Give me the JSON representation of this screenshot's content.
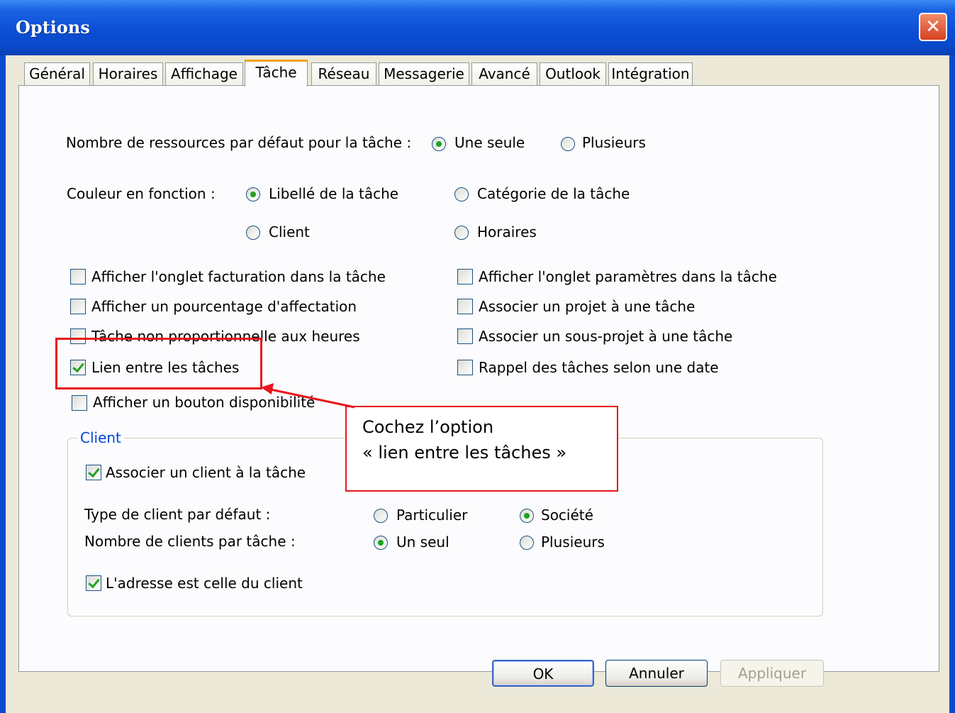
{
  "window": {
    "title": "Options"
  },
  "tabs": [
    "Général",
    "Horaires",
    "Affichage",
    "Tâche",
    "Réseau",
    "Messagerie",
    "Avancé",
    "Outlook",
    "Intégration"
  ],
  "active_tab": "Tâche",
  "task": {
    "resources_label": "Nombre de ressources par défaut pour la tâche :",
    "resources_one": "Une seule",
    "resources_many": "Plusieurs",
    "color_label": "Couleur en fonction :",
    "color_task_label": "Libellé de la tâche",
    "color_category": "Catégorie de la tâche",
    "color_client": "Client",
    "color_schedule": "Horaires",
    "checks_left": [
      {
        "label": "Afficher l'onglet facturation dans la tâche",
        "checked": false
      },
      {
        "label": "Afficher un pourcentage d'affectation",
        "checked": false
      },
      {
        "label": "Tâche non proportionnelle aux heures",
        "checked": false
      },
      {
        "label": "Lien entre les tâches",
        "checked": true
      },
      {
        "label": "Afficher un bouton disponibilité",
        "checked": false
      }
    ],
    "checks_right": [
      {
        "label": "Afficher l'onglet paramètres dans la tâche",
        "checked": false
      },
      {
        "label": "Associer un projet à une tâche",
        "checked": false
      },
      {
        "label": "Associer un sous-projet à une tâche",
        "checked": false
      },
      {
        "label": "Rappel des tâches selon une date",
        "checked": false
      }
    ]
  },
  "client_group": {
    "title": "Client",
    "associate": "Associer un client à la tâche",
    "type_label": "Type de client par défaut :",
    "type_individual": "Particulier",
    "type_company": "Société",
    "count_label": "Nombre de clients par tâche :",
    "count_one": "Un seul",
    "count_many": "Plusieurs",
    "address": "L'adresse est celle du client"
  },
  "buttons": {
    "ok": "OK",
    "cancel": "Annuler",
    "apply": "Appliquer"
  },
  "callout": {
    "line1": "Cochez l’option",
    "line2": "« lien entre les tâches »"
  },
  "colors": {
    "title_bar": "#0a4ad0",
    "dialog_bg": "#ece9d8",
    "annotation": "#e8151b",
    "group_title": "#0046d5"
  }
}
